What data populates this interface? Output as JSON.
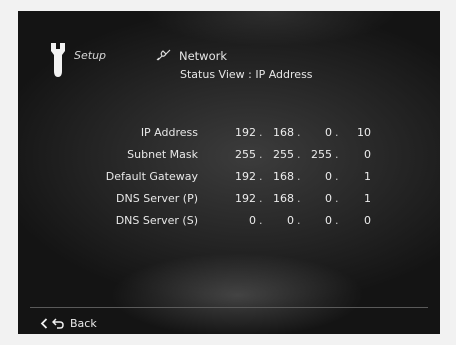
{
  "header": {
    "setup_label": "Setup",
    "network_label": "Network",
    "subtitle": "Status View : IP Address"
  },
  "rows": [
    {
      "label": "IP Address",
      "octets": [
        "192",
        "168",
        "0",
        "10"
      ]
    },
    {
      "label": "Subnet Mask",
      "octets": [
        "255",
        "255",
        "255",
        "0"
      ]
    },
    {
      "label": "Default Gateway",
      "octets": [
        "192",
        "168",
        "0",
        "1"
      ]
    },
    {
      "label": "DNS Server (P)",
      "octets": [
        "192",
        "168",
        "0",
        "1"
      ]
    },
    {
      "label": "DNS Server (S)",
      "octets": [
        "0",
        "0",
        "0",
        "0"
      ]
    }
  ],
  "separator": ".",
  "footer": {
    "back_label": "Back"
  },
  "icons": [
    "wrench-icon",
    "network-icon",
    "chevron-left-icon",
    "return-arrow-icon"
  ],
  "colors": {
    "background": "#262626",
    "text": "#e8e8e8"
  }
}
